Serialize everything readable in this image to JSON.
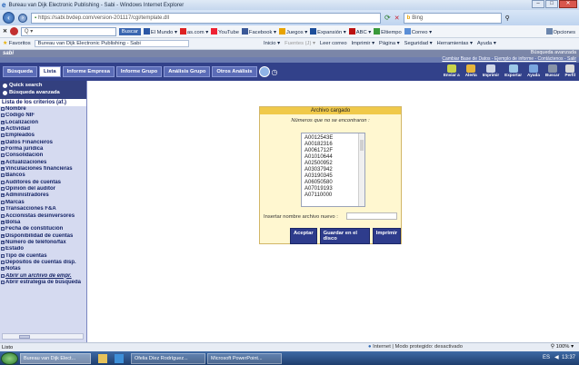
{
  "window": {
    "title": "Bureau van Dijk Electronic Publishing - Sabi - Windows Internet Explorer"
  },
  "address": {
    "url": "https://sabi.bvdep.com/version-201117/cgi/template.dll",
    "search_placeholder": "Bing"
  },
  "toolbar": {
    "search_button": "Buscar",
    "items": [
      "El Mundo ▾",
      "as.com ▾",
      "YouTube",
      "Facebook ▾",
      "Juegos ▾",
      "Expansión ▾",
      "ABC ▾",
      "Eltiempo",
      "Correo ▾"
    ],
    "options": "Opciones"
  },
  "favorites": {
    "label": "Favoritos",
    "tab": "Bureau van Dijk Electronic Publishing - Sabi",
    "cmds": [
      "Inicio ▾",
      "Fuentes (J) ▾",
      "Leer correo",
      "Imprimir ▾",
      "Página ▾",
      "Seguridad ▾",
      "Herramientas ▾",
      "Ayuda ▾"
    ]
  },
  "header": {
    "logo": "sabi",
    "right_top": "Búsqueda avanzada",
    "right_links": "Cambiar Base de Datos - Ejemplo de informe - Contáctenos - Salir"
  },
  "tabs": [
    "Búsqueda",
    "Lista",
    "Informe Empresa",
    "Informe Grupo",
    "Análisis Grupo",
    "Otros Análisis"
  ],
  "right_icons": [
    "Enviar a",
    "Alerta",
    "Imprimir",
    "Exportar",
    "Ayuda",
    "Buscar",
    "Perfil"
  ],
  "left": {
    "quick": "Quick search",
    "advanced": "Búsqueda avanzada",
    "list_header": "Lista de los criterios (af.)",
    "criteria": [
      {
        "label": "Nombre",
        "mark": "□",
        "it": false
      },
      {
        "label": "Código NIF",
        "mark": "□",
        "it": false
      },
      {
        "label": "Localización",
        "mark": "+",
        "it": false
      },
      {
        "label": "Actividad",
        "mark": "+",
        "it": false
      },
      {
        "label": "Empleados",
        "mark": "□",
        "it": false
      },
      {
        "label": "Datos Financieros",
        "mark": "+",
        "it": false
      },
      {
        "label": "Forma jurídica",
        "mark": "□",
        "it": false
      },
      {
        "label": "Consolidación",
        "mark": "□",
        "it": false
      },
      {
        "label": "Actualizaciones",
        "mark": "+",
        "it": false
      },
      {
        "label": "Vinculaciones financieras",
        "mark": "+",
        "it": false
      },
      {
        "label": "Bancos",
        "mark": "□",
        "it": false
      },
      {
        "label": "Auditores de cuentas",
        "mark": "□",
        "it": false
      },
      {
        "label": "Opinión del auditor",
        "mark": "□",
        "it": false
      },
      {
        "label": "Administradores",
        "mark": "+",
        "it": false
      },
      {
        "label": "Marcas",
        "mark": "□",
        "it": false
      },
      {
        "label": "Transacciones F&A",
        "mark": "□",
        "it": false
      },
      {
        "label": "Accionistas desinversores",
        "mark": "□",
        "it": false
      },
      {
        "label": "Bolsa",
        "mark": "+",
        "it": false
      },
      {
        "label": "Fecha de constitución",
        "mark": "□",
        "it": false
      },
      {
        "label": "Disponibilidad de cuentas",
        "mark": "+",
        "it": false
      },
      {
        "label": "Número de teléfono/fax",
        "mark": "+",
        "it": false
      },
      {
        "label": "Estado",
        "mark": "□",
        "it": false
      },
      {
        "label": "Tipo de cuentas",
        "mark": "□",
        "it": false
      },
      {
        "label": "Depósitos de cuentas disp.",
        "mark": "□",
        "it": false
      },
      {
        "label": "Notas",
        "mark": "+",
        "it": false
      },
      {
        "label": "Abrir un archivo de empr.",
        "mark": "□",
        "it": true
      },
      {
        "label": "Abrir estrategia de búsqueda",
        "mark": "□",
        "it": false
      }
    ]
  },
  "dialog": {
    "title": "Archivo cargado",
    "message": "Números que no se encontraron :",
    "numbers": [
      "A0012543E",
      "A00182316",
      "A0061712F",
      "A01010644",
      "A02500952",
      "A03037942",
      "A03190345",
      "A06050580",
      "A07019193",
      "A07110000"
    ],
    "insert_label": "Insertar nombre archivo nuevo :",
    "input_value": "",
    "buttons": [
      "Aceptar",
      "Guardar en el disco",
      "Imprimir"
    ]
  },
  "status": {
    "left": "Listo",
    "mid": "Internet | Modo protegido: desactivado",
    "zoom": "100%"
  },
  "taskbar": {
    "items": [
      "Bureau van Dijk Elect...",
      "Ofelia Díez Rodríguez...",
      "Microsoft PowerPoint..."
    ],
    "lang": "ES",
    "time": "13:37"
  }
}
